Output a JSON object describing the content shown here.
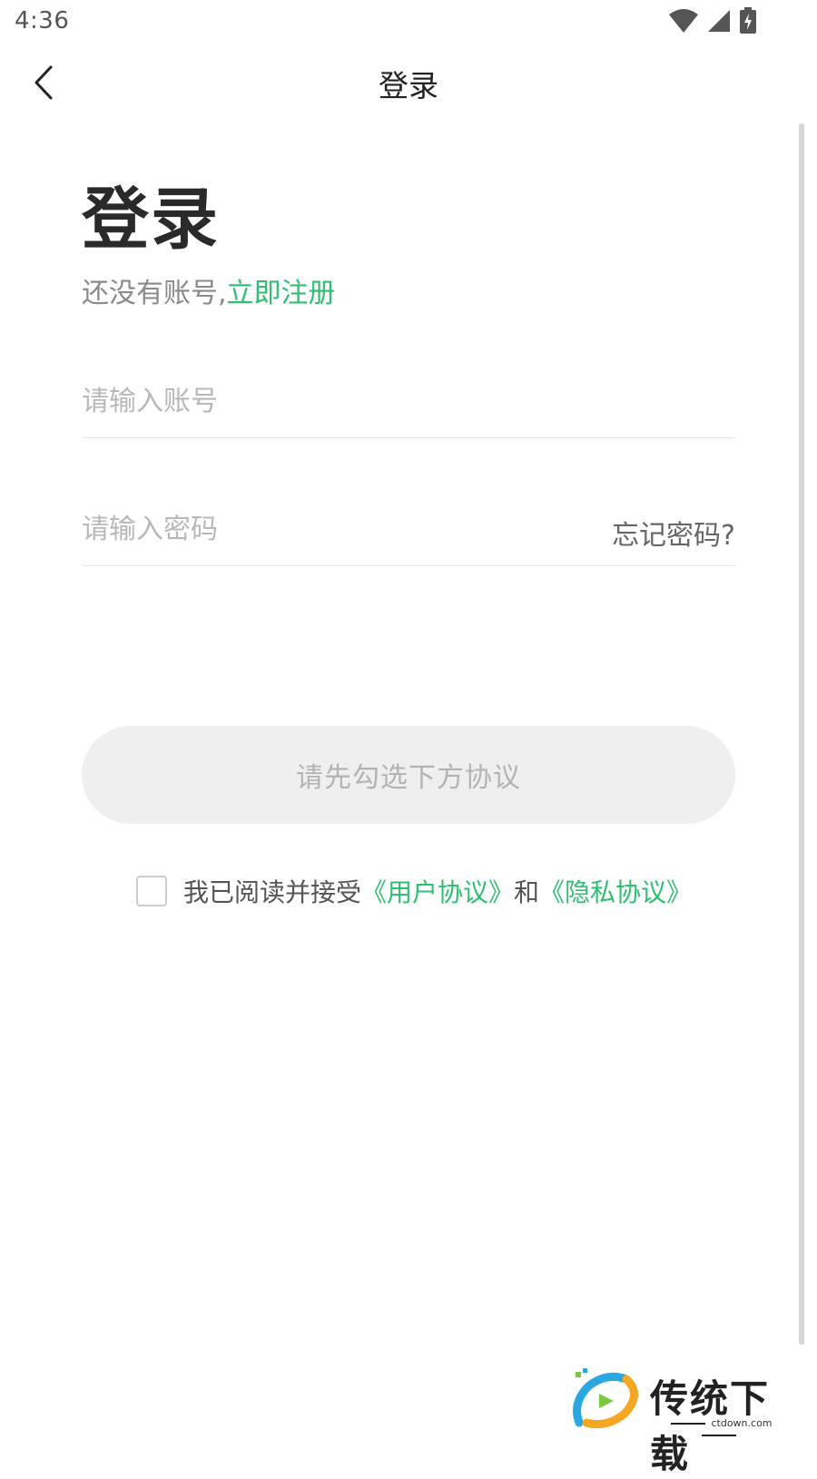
{
  "status_bar": {
    "time": "4:36"
  },
  "header": {
    "title": "登录"
  },
  "main": {
    "heading": "登录",
    "register_prefix": "还没有账号,",
    "register_link": "立即注册",
    "account_placeholder": "请输入账号",
    "password_placeholder": "请输入密码",
    "forgot_password": "忘记密码?",
    "login_button": "请先勾选下方协议",
    "agreement": {
      "prefix": "我已阅读并接受",
      "user_agreement": "《用户协议》",
      "conjunction": "和",
      "privacy_policy": "《隐私协议》"
    }
  },
  "watermark": {
    "brand": "传统下载",
    "domain": "ctdown.com"
  },
  "colors": {
    "accent": "#2fbf71",
    "button_bg": "#efefef",
    "button_text": "#b3b3b3"
  }
}
